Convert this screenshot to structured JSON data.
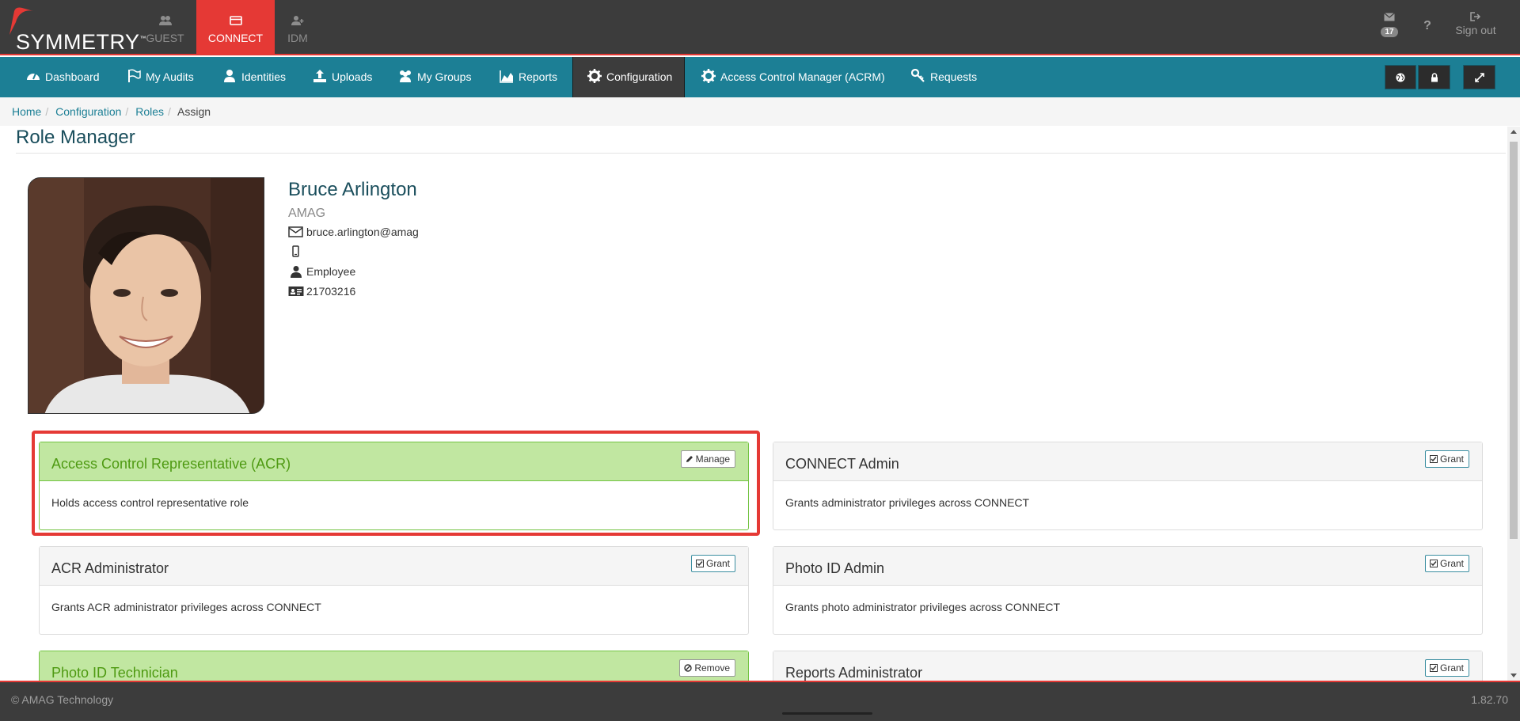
{
  "brand": {
    "logo_text": "SYMMETRY",
    "trademark": "™"
  },
  "app_tabs": [
    {
      "label": "GUEST",
      "icon": "users-icon",
      "active": false
    },
    {
      "label": "CONNECT",
      "icon": "card-icon",
      "active": true
    },
    {
      "label": "IDM",
      "icon": "user-plus-icon",
      "active": false
    }
  ],
  "top_right": {
    "messages": {
      "icon": "envelope-icon",
      "count": "17"
    },
    "help": {
      "label": "?"
    },
    "signout": {
      "icon": "sign-out-icon",
      "label": "Sign out"
    }
  },
  "nav": {
    "items": [
      {
        "label": "Dashboard",
        "icon": "dashboard-icon"
      },
      {
        "label": "My Audits",
        "icon": "flag-icon"
      },
      {
        "label": "Identities",
        "icon": "user-icon"
      },
      {
        "label": "Uploads",
        "icon": "upload-icon"
      },
      {
        "label": "My Groups",
        "icon": "group-icon"
      },
      {
        "label": "Reports",
        "icon": "area-chart-icon"
      },
      {
        "label": "Configuration",
        "icon": "gear-icon",
        "active": true
      },
      {
        "label": "Access Control Manager (ACRM)",
        "icon": "gear-icon"
      },
      {
        "label": "Requests",
        "icon": "key-icon"
      }
    ],
    "right_buttons": [
      "globe-icon",
      "lock-icon",
      "expand-icon"
    ]
  },
  "breadcrumb": [
    "Home",
    "Configuration",
    "Roles",
    "Assign"
  ],
  "page_title": "Role Manager",
  "profile": {
    "name": "Bruce Arlington",
    "org": "AMAG",
    "email": "bruce.arlington@amag",
    "phone": "",
    "type": "Employee",
    "id_number": "21703216"
  },
  "roles": [
    {
      "title": "Access Control Representative (ACR)",
      "description": "Holds access control representative role",
      "assigned": true,
      "action": "Manage",
      "action_icon": "pencil-icon",
      "highlighted": true
    },
    {
      "title": "CONNECT Admin",
      "description": "Grants administrator privileges across CONNECT",
      "assigned": false,
      "action": "Grant",
      "action_icon": "check-square-icon"
    },
    {
      "title": "ACR Administrator",
      "description": "Grants ACR administrator privileges across CONNECT",
      "assigned": false,
      "action": "Grant",
      "action_icon": "check-square-icon"
    },
    {
      "title": "Photo ID Admin",
      "description": "Grants photo administrator privileges across CONNECT",
      "assigned": false,
      "action": "Grant",
      "action_icon": "check-square-icon"
    },
    {
      "title": "Photo ID Technician",
      "description": "",
      "assigned": true,
      "action": "Remove",
      "action_icon": "ban-icon"
    },
    {
      "title": "Reports Administrator",
      "description": "",
      "assigned": false,
      "action": "Grant",
      "action_icon": "check-square-icon"
    }
  ],
  "footer": {
    "copyright": "© AMAG Technology",
    "version": "1.82.70"
  },
  "colors": {
    "accent_red": "#e53935",
    "nav_teal": "#1c7f95",
    "dark_bar": "#3c3c3c",
    "assigned_green": "#c1e7a1",
    "assigned_text": "#4e9a12"
  }
}
